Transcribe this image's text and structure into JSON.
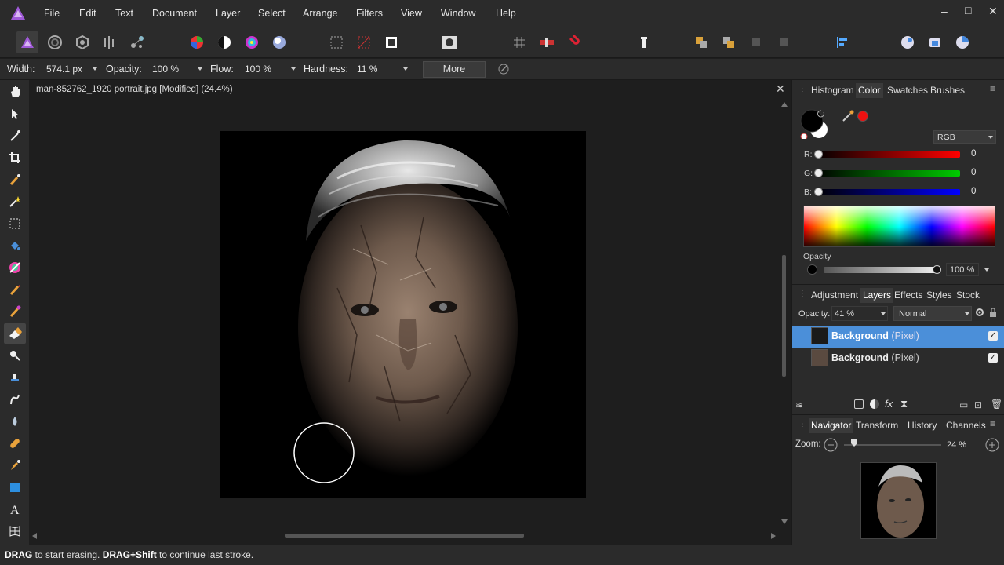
{
  "app": {
    "brand_color": "#a05ad8",
    "accent": "#4b8fd9"
  },
  "menu": [
    "File",
    "Edit",
    "Text",
    "Document",
    "Layer",
    "Select",
    "Arrange",
    "Filters",
    "View",
    "Window",
    "Help"
  ],
  "context_toolbar": {
    "width_label": "Width:",
    "width_value": "574.1 px",
    "opacity_label": "Opacity:",
    "opacity_value": "100 %",
    "flow_label": "Flow:",
    "flow_value": "100 %",
    "hardness_label": "Hardness:",
    "hardness_value": "11 %",
    "more_label": "More"
  },
  "document": {
    "title": "man-852762_1920 portrait.jpg [Modified] (24.4%)"
  },
  "color_panel": {
    "tabs": [
      "Histogram",
      "Color",
      "Swatches",
      "Brushes"
    ],
    "selected_tab": "Color",
    "mode": "RGB",
    "r_label": "R:",
    "g_label": "G:",
    "b_label": "B:",
    "r": "0",
    "g": "0",
    "b": "0",
    "opacity_label": "Opacity",
    "opacity_value": "100 %"
  },
  "layers_panel": {
    "tabs": [
      "Adjustment",
      "Layers",
      "Effects",
      "Styles",
      "Stock"
    ],
    "selected_tab": "Layers",
    "opacity_label": "Opacity:",
    "opacity_value": "41 %",
    "blend_mode": "Normal",
    "layers": [
      {
        "name": "Background",
        "type": "(Pixel)",
        "selected": true,
        "visible": true
      },
      {
        "name": "Background",
        "type": "(Pixel)",
        "selected": false,
        "visible": true
      }
    ]
  },
  "navigator_panel": {
    "tabs": [
      "Navigator",
      "Transform",
      "History",
      "Channels"
    ],
    "selected_tab": "Navigator",
    "zoom_label": "Zoom:",
    "zoom_value": "24 %"
  },
  "status": {
    "drag": "DRAG",
    "drag_text": " to start erasing. ",
    "drag_shift": "DRAG+Shift",
    "shift_text": " to continue last stroke."
  }
}
